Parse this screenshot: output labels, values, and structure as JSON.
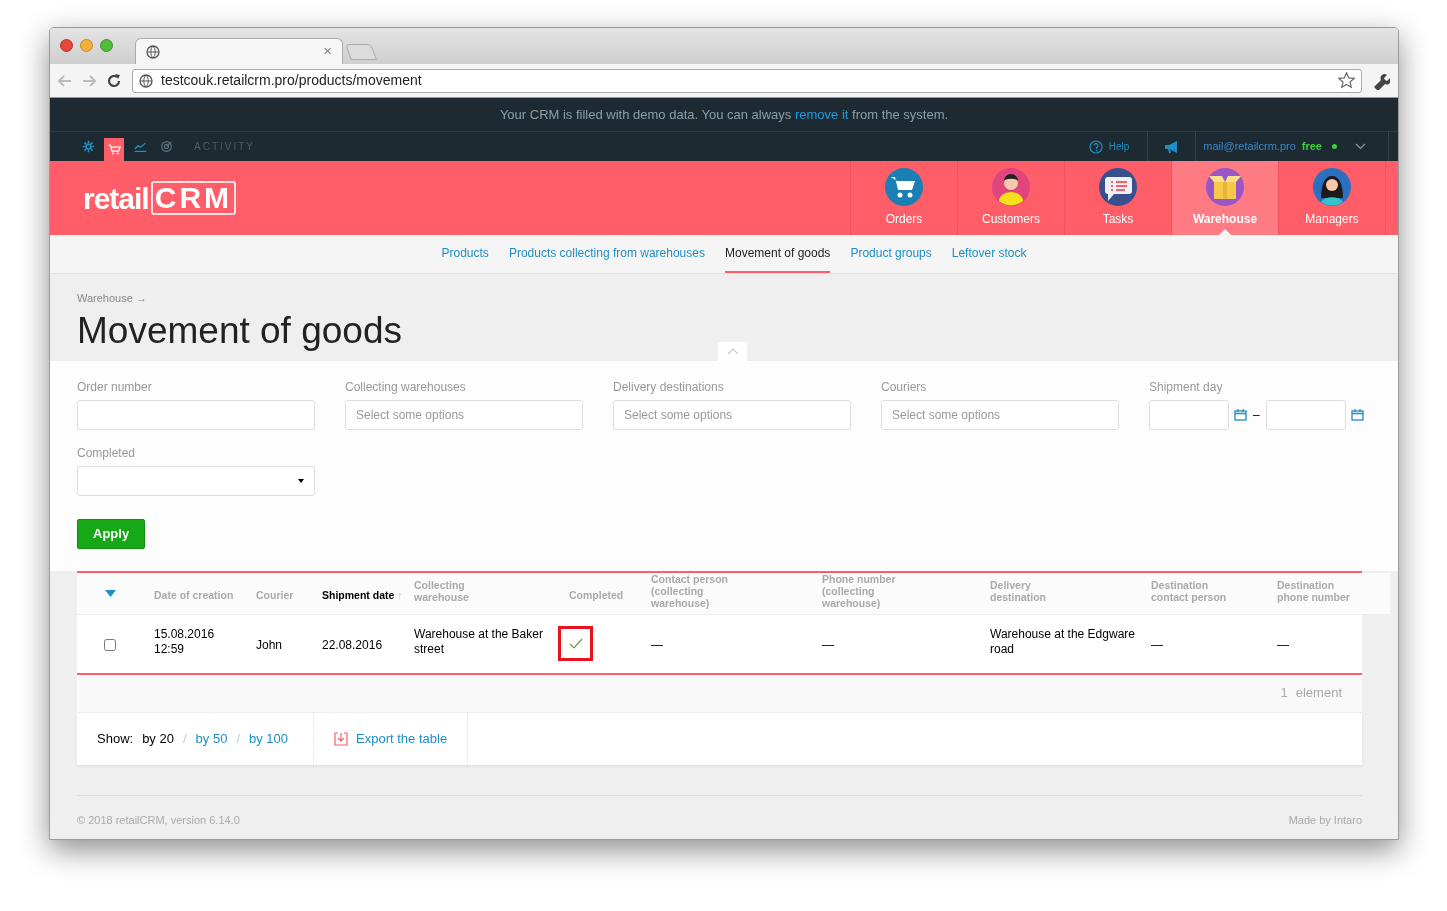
{
  "browser": {
    "tab_close": "×",
    "url": "testcouk.retailcrm.pro/products/movement"
  },
  "banner": {
    "text_before": "Your CRM is filled with demo data. You can always ",
    "link": "remove it",
    "text_after": " from the system."
  },
  "toolbar": {
    "tools": [
      {
        "kind": "settings",
        "selected": false
      },
      {
        "kind": "cart",
        "selected": true
      },
      {
        "kind": "chart",
        "selected": false
      },
      {
        "kind": "target",
        "selected": false
      }
    ],
    "activity": "ACTIVITY",
    "help": "Help",
    "email": "mail@retailcrm.pro",
    "plan": "free"
  },
  "header": {
    "logo_left": "retail",
    "logo_right": "CRM",
    "nav": [
      {
        "label": "Orders",
        "kind": "cart",
        "selected": false
      },
      {
        "label": "Customers",
        "kind": "person",
        "selected": false
      },
      {
        "label": "Tasks",
        "kind": "chat",
        "selected": false
      },
      {
        "label": "Warehouse",
        "kind": "box",
        "selected": true
      },
      {
        "label": "Managers",
        "kind": "manager",
        "selected": false
      }
    ]
  },
  "subnav": [
    {
      "label": "Products",
      "selected": false
    },
    {
      "label": "Products collecting from warehouses",
      "selected": false
    },
    {
      "label": "Movement of goods",
      "selected": true
    },
    {
      "label": "Product groups",
      "selected": false
    },
    {
      "label": "Leftover stock",
      "selected": false
    }
  ],
  "breadcrumb": "Warehouse →",
  "title": "Movement of goods",
  "filters": [
    {
      "kind": "text",
      "label": "Order number"
    },
    {
      "kind": "multiselect",
      "label": "Collecting warehouses",
      "placeholder": "Select some options"
    },
    {
      "kind": "multiselect",
      "label": "Delivery destinations",
      "placeholder": "Select some options"
    },
    {
      "kind": "multiselect",
      "label": "Couriers",
      "placeholder": "Select some options"
    },
    {
      "kind": "daterange",
      "label": "Shipment day",
      "separator": "–"
    },
    {
      "kind": "select",
      "label": "Completed"
    }
  ],
  "apply": "Apply",
  "table": {
    "columns": [
      {
        "label": "Date of creation",
        "active": false
      },
      {
        "label": "Courier",
        "active": false
      },
      {
        "label": "Shipment date",
        "active": true,
        "sort_arrow": "↑"
      },
      {
        "label": "Collecting warehouse",
        "active": false
      },
      {
        "label": "Completed",
        "active": false
      },
      {
        "label": "Contact person (collecting warehouse)",
        "active": false
      },
      {
        "label": "Phone number (collecting warehouse)",
        "active": false
      },
      {
        "label": "Delivery destination",
        "active": false
      },
      {
        "label": "Destination contact person",
        "active": false
      },
      {
        "label": "Destination phone number",
        "active": false
      }
    ],
    "rows": [
      {
        "checked": false,
        "completed": true,
        "cells": [
          "15.08.2016 12:59",
          "John",
          "22.08.2016",
          "Warehouse at the Baker street",
          "",
          "—",
          "—",
          "Warehouse at the Edgware road",
          "—",
          "—"
        ]
      }
    ]
  },
  "count": {
    "number": "1",
    "label": "element"
  },
  "show": {
    "label": "Show:",
    "options": [
      {
        "label": "by 20",
        "selected": true
      },
      {
        "label": "by 50",
        "selected": false
      },
      {
        "label": "by 100",
        "selected": false
      }
    ],
    "separator": "/"
  },
  "export": "Export the table",
  "footer": {
    "copyright": "© 2018 retailCRM, version 6.14.0",
    "made_by": "Made by Intaro"
  }
}
